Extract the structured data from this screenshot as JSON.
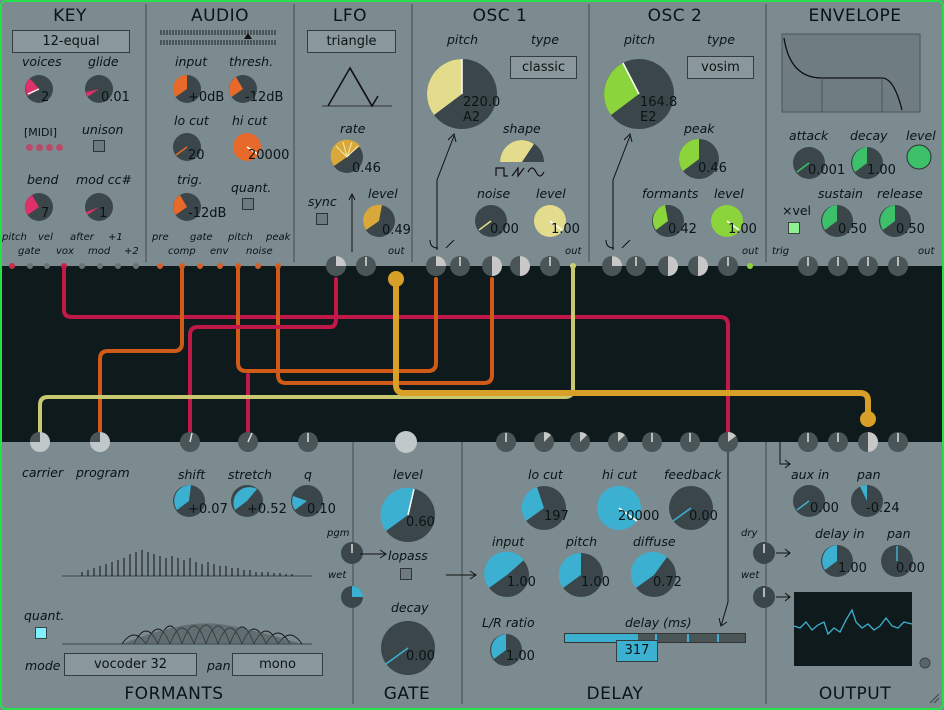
{
  "sections": {
    "key": "KEY",
    "audio": "AUDIO",
    "lfo": "LFO",
    "osc1": "OSC 1",
    "osc2": "OSC 2",
    "envelope": "ENVELOPE",
    "formants": "FORMANTS",
    "gate": "GATE",
    "delay": "DELAY",
    "output": "OUTPUT"
  },
  "key": {
    "tuning": "12-equal",
    "voices_label": "voices",
    "voices": "2",
    "glide_label": "glide",
    "glide": "0.01",
    "midi_label": "[MIDI]",
    "unison_label": "unison",
    "bend_label": "bend",
    "bend": "7",
    "modcc_label": "mod cc#",
    "modcc": "1",
    "ports": [
      "pitch",
      "gate",
      "vel",
      "vox",
      "after",
      "mod",
      "+1",
      "+2"
    ]
  },
  "audio": {
    "input_label": "input",
    "input": "+0dB",
    "thresh_label": "thresh.",
    "thresh": "-12dB",
    "locut_label": "lo cut",
    "locut": "20",
    "hicut_label": "hi cut",
    "hicut": "20000",
    "trig_label": "trig.",
    "trig": "-12dB",
    "quant_label": "quant.",
    "ports": [
      "pre",
      "comp",
      "gate",
      "env",
      "pitch",
      "noise",
      "peak"
    ]
  },
  "lfo": {
    "shape": "triangle",
    "rate_label": "rate",
    "rate": "0.46",
    "sync_label": "sync",
    "level_label": "level",
    "level": "0.49",
    "out_label": "out"
  },
  "osc1": {
    "pitch_label": "pitch",
    "type_label": "type",
    "type": "classic",
    "pitch_hz": "220.0",
    "pitch_note": "A2",
    "shape_label": "shape",
    "noise_label": "noise",
    "noise": "0.00",
    "level_label": "level",
    "level": "1.00",
    "out_label": "out"
  },
  "osc2": {
    "pitch_label": "pitch",
    "type_label": "type",
    "type": "vosim",
    "pitch_hz": "164.8",
    "pitch_note": "E2",
    "peak_label": "peak",
    "peak": "0.46",
    "formants_label": "formants",
    "formants": "0.42",
    "level_label": "level",
    "level": "1.00",
    "out_label": "out"
  },
  "envelope": {
    "attack_label": "attack",
    "attack": "0.001",
    "decay_label": "decay",
    "decay": "1.00",
    "level_label": "level",
    "xvel_label": "×vel",
    "sustain_label": "sustain",
    "sustain": "0.50",
    "release_label": "release",
    "release": "0.50",
    "trig_label": "trig",
    "out_label": "out"
  },
  "formants": {
    "carrier_label": "carrier",
    "program_label": "program",
    "shift_label": "shift",
    "shift": "+0.07",
    "stretch_label": "stretch",
    "stretch": "+0.52",
    "q_label": "q",
    "q": "0.10",
    "quant_label": "quant.",
    "mode_label": "mode",
    "mode": "vocoder 32",
    "pan_label": "pan",
    "pan": "mono"
  },
  "gate": {
    "level_label": "level",
    "level": "0.60",
    "pgm_label": "pgm",
    "wet_label": "wet",
    "lopass_label": "lopass",
    "decay_label": "decay",
    "decay": "0.00"
  },
  "delay": {
    "locut_label": "lo cut",
    "locut": "197",
    "hicut_label": "hi cut",
    "hicut": "20000",
    "feedback_label": "feedback",
    "feedback": "0.00",
    "input_label": "input",
    "input": "1.00",
    "pitch_label": "pitch",
    "pitch": "1.00",
    "diffuse_label": "diffuse",
    "diffuse": "0.72",
    "lr_label": "L/R ratio",
    "lr": "1.00",
    "time_label": "delay (ms)",
    "time": "317"
  },
  "output": {
    "dry_label": "dry",
    "wet_label": "wet",
    "auxin_label": "aux in",
    "auxin": "0.00",
    "pan1_label": "pan",
    "pan1": "-0.24",
    "delayin_label": "delay in",
    "delayin": "1.00",
    "pan2_label": "pan",
    "pan2": "0.00"
  },
  "colors": {
    "key": "#e0306a",
    "audio": "#e86a2a",
    "lfo": "#d8a83a",
    "osc1": "#e2dc8c",
    "osc2": "#8cd43c",
    "envelope": "#3cc06a",
    "formants": "#3cb0d0",
    "patch_bg": "#0f1a1c",
    "cable_red": "#c01848",
    "cable_orange": "#d05a18",
    "cable_gold": "#d8a028",
    "cable_pale": "#c8c870"
  }
}
